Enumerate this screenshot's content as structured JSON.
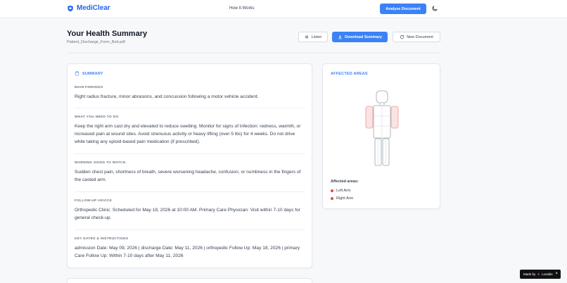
{
  "nav": {
    "brand": "MediClear",
    "link": "How It Works",
    "analyse_button": "Analyse Document"
  },
  "header": {
    "title": "Your Health Summary",
    "filename": "Patient_Discharge_Form_Bob.pdf",
    "listen": "Listen",
    "download": "Download Summary",
    "new_document": "New Document"
  },
  "summary": {
    "heading": "SUMMARY",
    "sections": [
      {
        "title": "MAIN FINDINGS",
        "text": "Right radius fracture, minor abrasions, and concussion following a motor vehicle accident."
      },
      {
        "title": "WHAT YOU NEED TO DO",
        "text": "Keep the right arm cast dry and elevated to reduce swelling. Monitor for signs of infection: redness, warmth, or increased pain at wound sites. Avoid strenuous activity or heavy lifting (over 5 lbs) for 4 weeks. Do not drive while taking any opioid-based pain medication (if prescribed)."
      },
      {
        "title": "WARNING SIGNS TO WATCH",
        "text": "Sudden chest pain, shortness of breath, severe worsening headache, confusion, or numbness in the fingers of the casted arm."
      },
      {
        "title": "FOLLOW-UP ADVICE",
        "text": "Orthopedic Clinic: Scheduled for May 18, 2026 at 10:00 AM. Primary Care Physician: Visit within 7-10 days for general check-up."
      },
      {
        "title": "KEY DATES & INSTRUCTIONS",
        "text": "admission Date: May 09, 2026 | discharge Date: May 11, 2026 | orthopedic Follow Up: May 18, 2026 | primary Care Follow Up: Within 7-10 days after May 11, 2026"
      }
    ]
  },
  "areas": {
    "heading": "AFFECTED AREAS",
    "subheading": "Affected areas:",
    "items": [
      "Left Arm",
      "Right Arm"
    ],
    "highlight_color": "#ef4444"
  },
  "footer": {
    "made_by": "Made by",
    "brand": "Lovable"
  },
  "colors": {
    "accent": "#3b82f6",
    "brand": "#2563eb"
  }
}
